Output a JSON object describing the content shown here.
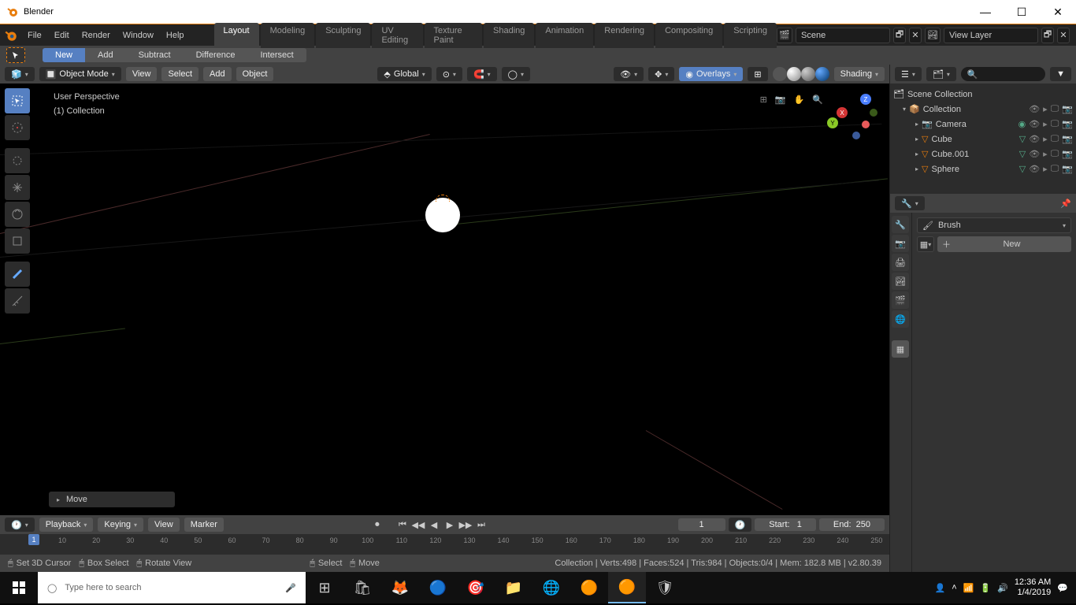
{
  "window": {
    "title": "Blender"
  },
  "menu": {
    "items": [
      "File",
      "Edit",
      "Render",
      "Window",
      "Help"
    ]
  },
  "workspaces": {
    "items": [
      "Layout",
      "Modeling",
      "Sculpting",
      "UV Editing",
      "Texture Paint",
      "Shading",
      "Animation",
      "Rendering",
      "Compositing",
      "Scripting"
    ],
    "active": "Layout"
  },
  "scene_bar": {
    "scene_label": "Scene",
    "viewlayer_label": "View Layer"
  },
  "bool_tool": {
    "cursor_icon": true,
    "tabs": [
      "New",
      "Add",
      "Subtract",
      "Difference",
      "Intersect"
    ],
    "active": "New"
  },
  "viewport_header": {
    "mode": "Object Mode",
    "menus": [
      "View",
      "Select",
      "Add",
      "Object"
    ],
    "orientation": "Global",
    "overlays": "Overlays",
    "shading_label": "Shading"
  },
  "viewport": {
    "perspective": "User Perspective",
    "collection": "(1) Collection",
    "move_panel": "Move",
    "axes": {
      "x": "X",
      "y": "Y",
      "z": "Z"
    }
  },
  "timeline": {
    "menus": [
      "Playback",
      "Keying",
      "View",
      "Marker"
    ],
    "current": "1",
    "start_label": "Start:",
    "start": "1",
    "end_label": "End:",
    "end": "250",
    "ticks": [
      10,
      20,
      30,
      40,
      50,
      60,
      70,
      80,
      90,
      100,
      110,
      120,
      130,
      140,
      150,
      160,
      170,
      180,
      190,
      200,
      210,
      220,
      230,
      240,
      250
    ],
    "playhead": "1"
  },
  "status_left": [
    {
      "icon": "🖱",
      "label": "Set 3D Cursor"
    },
    {
      "icon": "🖱",
      "label": "Box Select"
    },
    {
      "icon": "🖱",
      "label": "Rotate View"
    },
    {
      "icon": "🖱",
      "label": "Select"
    },
    {
      "icon": "🖱",
      "label": "Move"
    }
  ],
  "status_right": "Collection | Verts:498 | Faces:524 | Tris:984 | Objects:0/4 | Mem: 182.8 MB | v2.80.39",
  "outliner": {
    "root": "Scene Collection",
    "collection": "Collection",
    "items": [
      {
        "name": "Camera",
        "icon": "camera",
        "color": "#e87d0d",
        "extra": "aperture"
      },
      {
        "name": "Cube",
        "icon": "mesh",
        "color": "#e87d0d"
      },
      {
        "name": "Cube.001",
        "icon": "mesh",
        "color": "#e87d0d"
      },
      {
        "name": "Sphere",
        "icon": "mesh",
        "color": "#e87d0d"
      }
    ]
  },
  "properties": {
    "brush_label": "Brush",
    "new_label": "New"
  },
  "taskbar": {
    "search_placeholder": "Type here to search",
    "time": "12:36 AM",
    "date": "1/4/2019"
  }
}
